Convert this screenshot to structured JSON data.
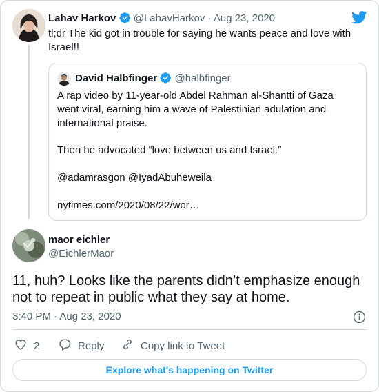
{
  "first_tweet": {
    "name": "Lahav Harkov",
    "handle": "@LahavHarkov",
    "separator": "·",
    "date": "Aug 23, 2020",
    "text_line1": "tl;dr The kid got in trouble for saying he wants peace and love with",
    "text_line2": "Israel!!"
  },
  "quoted_tweet": {
    "name": "David Halbfinger",
    "handle": "@halbfinger",
    "line1": "A rap video by 11-year-old Abdel Rahman al-Shantti of Gaza",
    "line2": "went viral, earning him a wave of Palestinian adulation and",
    "line3": "international praise.",
    "line4": "Then he advocated “love between us and Israel.”",
    "line5": "@adamrasgon @IyadAbuheweila",
    "line6": "nytimes.com/2020/08/22/wor…"
  },
  "main_tweet": {
    "name": "maor eichler",
    "handle": "@EichlerMaor",
    "text_line1": "11, huh? Looks like the parents didn’t emphasize enough",
    "text_line2": "not to repeat in public what they say at home.",
    "time": "3:40 PM",
    "separator": "·",
    "date": "Aug 23, 2020"
  },
  "actions": {
    "like_count": "2",
    "reply_label": "Reply",
    "copy_link_label": "Copy link to Tweet"
  },
  "explore_label": "Explore what's happening on Twitter",
  "colors": {
    "accent": "#1d9bf0",
    "muted": "#536471",
    "border": "#cfd9de",
    "text": "#0f1419"
  },
  "icons": [
    "twitter-bird-icon",
    "verified-badge-icon",
    "info-icon",
    "heart-icon",
    "reply-icon",
    "link-icon"
  ]
}
